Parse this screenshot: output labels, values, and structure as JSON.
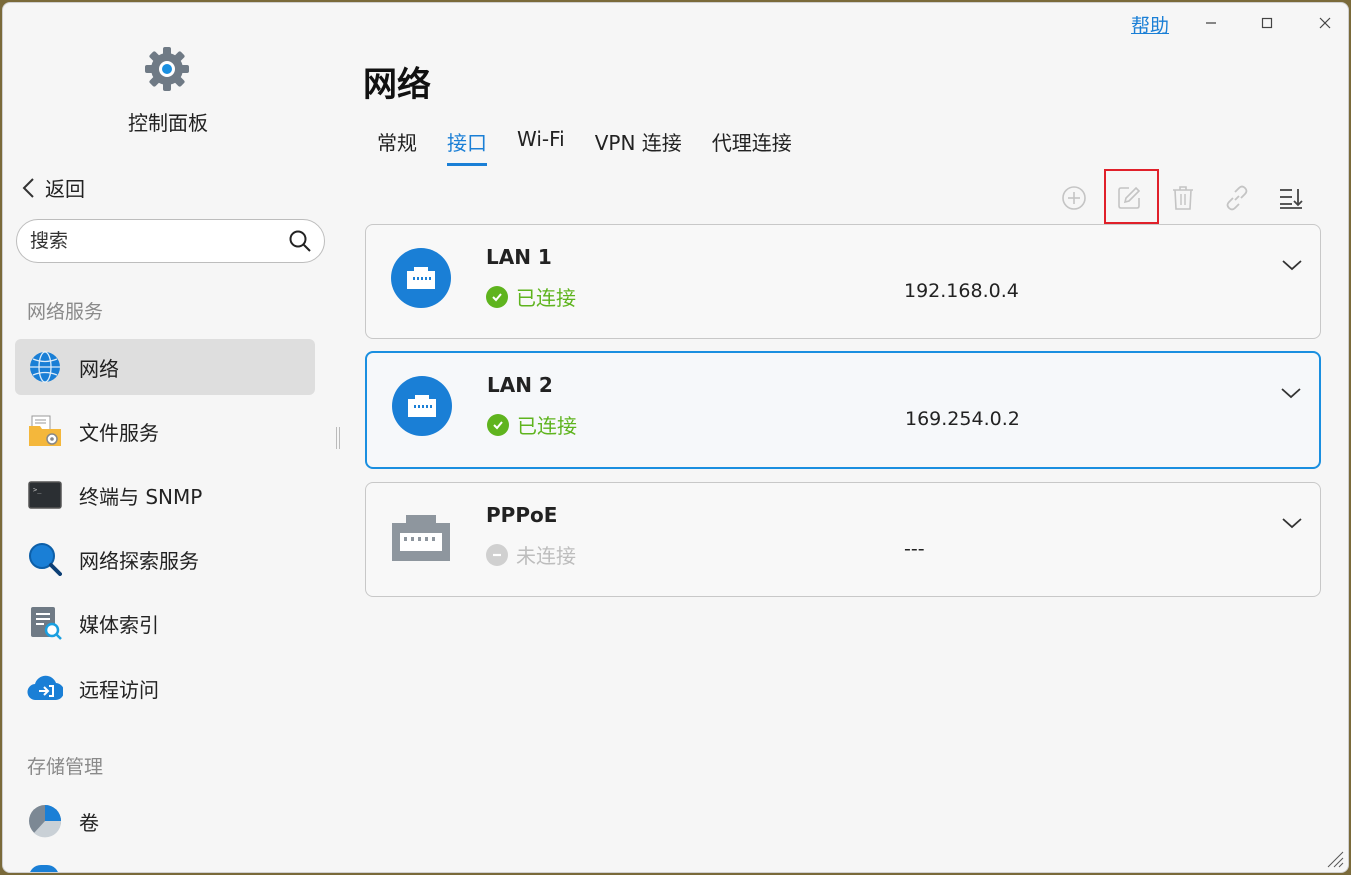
{
  "window": {
    "help_label": "帮助",
    "minimize_icon": "minimize-icon",
    "maximize_icon": "maximize-icon",
    "close_icon": "close-icon"
  },
  "sidebar": {
    "app_title": "控制面板",
    "back_label": "返回",
    "search_placeholder": "搜索",
    "sections": [
      {
        "label": "网络服务",
        "items": [
          {
            "label": "网络",
            "icon": "globe-icon",
            "active": true
          },
          {
            "label": "文件服务",
            "icon": "folder-icon"
          },
          {
            "label": "终端与 SNMP",
            "icon": "terminal-icon"
          },
          {
            "label": "网络探索服务",
            "icon": "search-discovery-icon"
          },
          {
            "label": "媒体索引",
            "icon": "media-index-icon"
          },
          {
            "label": "远程访问",
            "icon": "cloud-access-icon"
          }
        ]
      },
      {
        "label": "存储管理",
        "items": [
          {
            "label": "卷",
            "icon": "volume-pie-icon"
          }
        ]
      }
    ]
  },
  "main": {
    "title": "网络",
    "tabs": [
      {
        "label": "常规"
      },
      {
        "label": "接口",
        "active": true
      },
      {
        "label": "Wi-Fi"
      },
      {
        "label": "VPN 连接"
      },
      {
        "label": "代理连接"
      }
    ],
    "toolbar": [
      "add-icon",
      "edit-icon",
      "delete-icon",
      "link-icon",
      "sort-icon"
    ],
    "interfaces": [
      {
        "name": "LAN 1",
        "status": "已连接",
        "connected": true,
        "ip": "192.168.0.4"
      },
      {
        "name": "LAN 2",
        "status": "已连接",
        "connected": true,
        "ip": "169.254.0.2",
        "selected": true
      },
      {
        "name": "PPPoE",
        "status": "未连接",
        "connected": false,
        "ip": "---"
      }
    ]
  },
  "colors": {
    "accent": "#1a7fd6",
    "connected": "#5fb41e",
    "disconnected": "#bdbdbd",
    "highlight_box": "#e0202a"
  }
}
